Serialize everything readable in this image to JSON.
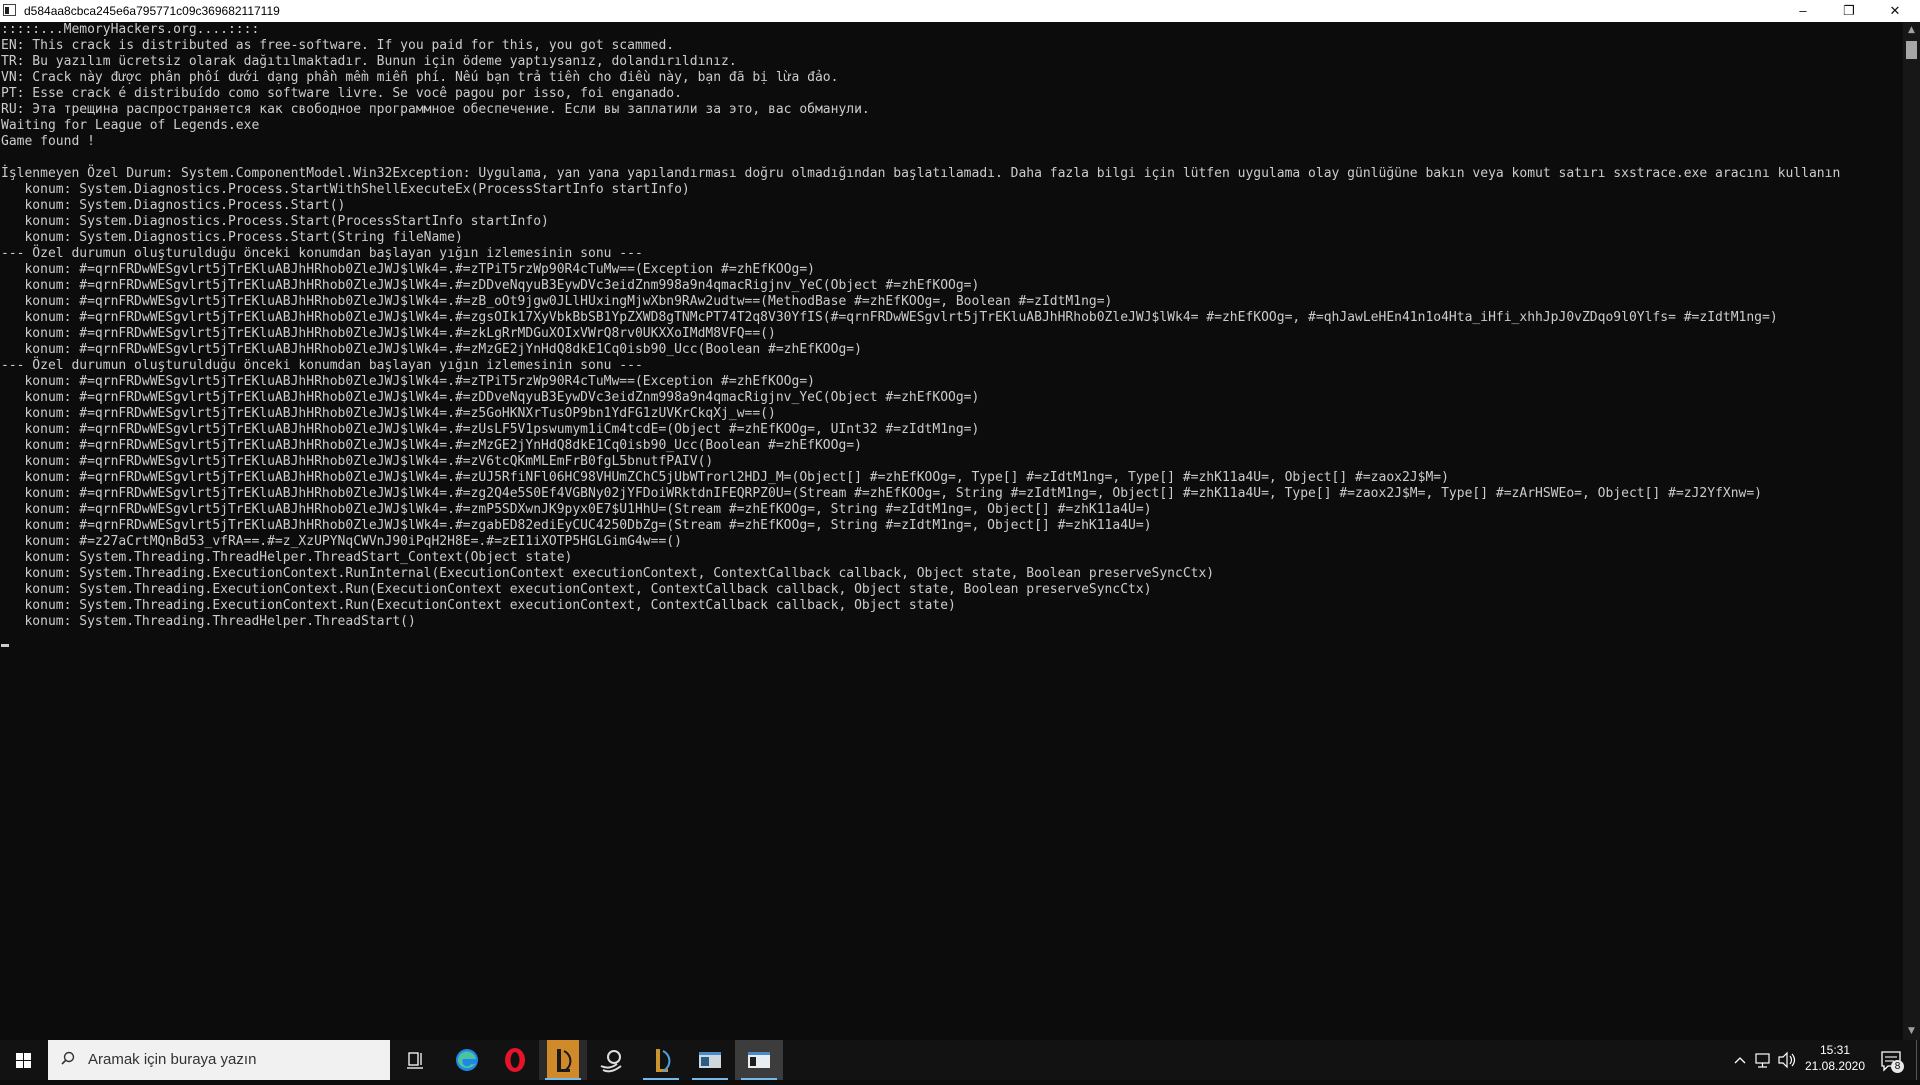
{
  "window": {
    "title": "d584aa8cbca245e6a795771c09c369682117119",
    "controls": {
      "minimize": "–",
      "restore": "❐",
      "close": "✕"
    }
  },
  "console": {
    "lines": [
      ":::::...MemoryHackers.org....::::",
      "EN: This crack is distributed as free-software. If you paid for this, you got scammed.",
      "TR: Bu yazılım ücretsiz olarak dağıtılmaktadır. Bunun için ödeme yaptıysanız, dolandırıldınız.",
      "VN: Crack này được phân phối dưới dạng phần mềm miễn phí. Nếu bạn trả tiền cho điều này, bạn đã bị lừa đảo.",
      "PT: Esse crack é distribuído como software livre. Se você pagou por isso, foi enganado.",
      "RU: Эта трещина распространяется как свободное программное обеспечение. Если вы заплатили за это, вас обманули.",
      "Waiting for League of Legends.exe",
      "Game found !",
      "",
      "İşlenmeyen Özel Durum: System.ComponentModel.Win32Exception: Uygulama, yan yana yapılandırması doğru olmadığından başlatılamadı. Daha fazla bilgi için lütfen uygulama olay günlüğüne bakın veya komut satırı sxstrace.exe aracını kullanın",
      "   konum: System.Diagnostics.Process.StartWithShellExecuteEx(ProcessStartInfo startInfo)",
      "   konum: System.Diagnostics.Process.Start()",
      "   konum: System.Diagnostics.Process.Start(ProcessStartInfo startInfo)",
      "   konum: System.Diagnostics.Process.Start(String fileName)",
      "--- Özel durumun oluşturulduğu önceki konumdan başlayan yığın izlemesinin sonu ---",
      "   konum: #=qrnFRDwWESgvlrt5jTrEKluABJhHRhob0ZleJWJ$lWk4=.#=zTPiT5rzWp90R4cTuMw==(Exception #=zhEfKOOg=)",
      "   konum: #=qrnFRDwWESgvlrt5jTrEKluABJhHRhob0ZleJWJ$lWk4=.#=zDDveNqyuB3EywDVc3eidZnm998a9n4qmacRigjnv_YeC(Object #=zhEfKOOg=)",
      "   konum: #=qrnFRDwWESgvlrt5jTrEKluABJhHRhob0ZleJWJ$lWk4=.#=zB_oOt9jgw0JLlHUxingMjwXbn9RAw2udtw==(MethodBase #=zhEfKOOg=, Boolean #=zIdtM1ng=)",
      "   konum: #=qrnFRDwWESgvlrt5jTrEKluABJhHRhob0ZleJWJ$lWk4=.#=zgsOIk17XyVbkBbSB1YpZXWD8gTNMcPT74T2q8V30YfIS(#=qrnFRDwWESgvlrt5jTrEKluABJhHRhob0ZleJWJ$lWk4= #=zhEfKOOg=, #=qhJawLeHEn41n1o4Hta_iHfi_xhhJpJ0vZDqo9l0Ylfs= #=zIdtM1ng=)",
      "   konum: #=qrnFRDwWESgvlrt5jTrEKluABJhHRhob0ZleJWJ$lWk4=.#=zkLgRrMDGuXOIxVWrQ8rv0UKXXoIMdM8VFQ==()",
      "   konum: #=qrnFRDwWESgvlrt5jTrEKluABJhHRhob0ZleJWJ$lWk4=.#=zMzGE2jYnHdQ8dkE1Cq0isb90_Ucc(Boolean #=zhEfKOOg=)",
      "--- Özel durumun oluşturulduğu önceki konumdan başlayan yığın izlemesinin sonu ---",
      "   konum: #=qrnFRDwWESgvlrt5jTrEKluABJhHRhob0ZleJWJ$lWk4=.#=zTPiT5rzWp90R4cTuMw==(Exception #=zhEfKOOg=)",
      "   konum: #=qrnFRDwWESgvlrt5jTrEKluABJhHRhob0ZleJWJ$lWk4=.#=zDDveNqyuB3EywDVc3eidZnm998a9n4qmacRigjnv_YeC(Object #=zhEfKOOg=)",
      "   konum: #=qrnFRDwWESgvlrt5jTrEKluABJhHRhob0ZleJWJ$lWk4=.#=z5GoHKNXrTusOP9bn1YdFG1zUVKrCkqXj_w==()",
      "   konum: #=qrnFRDwWESgvlrt5jTrEKluABJhHRhob0ZleJWJ$lWk4=.#=zUsLF5V1pswumym1iCm4tcdE=(Object #=zhEfKOOg=, UInt32 #=zIdtM1ng=)",
      "   konum: #=qrnFRDwWESgvlrt5jTrEKluABJhHRhob0ZleJWJ$lWk4=.#=zMzGE2jYnHdQ8dkE1Cq0isb90_Ucc(Boolean #=zhEfKOOg=)",
      "   konum: #=qrnFRDwWESgvlrt5jTrEKluABJhHRhob0ZleJWJ$lWk4=.#=zV6tcQKmMLEmFrB0fgL5bnutfPAIV()",
      "   konum: #=qrnFRDwWESgvlrt5jTrEKluABJhHRhob0ZleJWJ$lWk4=.#=zUJ5RfiNFl06HC98VHUmZChC5jUbWTrorl2HDJ_M=(Object[] #=zhEfKOOg=, Type[] #=zIdtM1ng=, Type[] #=zhK11a4U=, Object[] #=zaox2J$M=)",
      "   konum: #=qrnFRDwWESgvlrt5jTrEKluABJhHRhob0ZleJWJ$lWk4=.#=zg2Q4e5S0Ef4VGBNy02jYFDoiWRktdnIFEQRPZ0U=(Stream #=zhEfKOOg=, String #=zIdtM1ng=, Object[] #=zhK11a4U=, Type[] #=zaox2J$M=, Type[] #=zArHSWEo=, Object[] #=zJ2YfXnw=)",
      "   konum: #=qrnFRDwWESgvlrt5jTrEKluABJhHRhob0ZleJWJ$lWk4=.#=zmP5SDXwnJK9pyx0E7$U1HhU=(Stream #=zhEfKOOg=, String #=zIdtM1ng=, Object[] #=zhK11a4U=)",
      "   konum: #=qrnFRDwWESgvlrt5jTrEKluABJhHRhob0ZleJWJ$lWk4=.#=zgabED82ediEyCUC4250DbZg=(Stream #=zhEfKOOg=, String #=zIdtM1ng=, Object[] #=zhK11a4U=)",
      "   konum: #=z27aCrtMQnBd53_vfRA==.#=z_XzUPYNqCWVnJ90iPqH2H8E=.#=zEI1iXOTP5HGLGimG4w==()",
      "   konum: System.Threading.ThreadHelper.ThreadStart_Context(Object state)",
      "   konum: System.Threading.ExecutionContext.RunInternal(ExecutionContext executionContext, ContextCallback callback, Object state, Boolean preserveSyncCtx)",
      "   konum: System.Threading.ExecutionContext.Run(ExecutionContext executionContext, ContextCallback callback, Object state, Boolean preserveSyncCtx)",
      "   konum: System.Threading.ExecutionContext.Run(ExecutionContext executionContext, ContextCallback callback, Object state)",
      "   konum: System.Threading.ThreadHelper.ThreadStart()"
    ]
  },
  "scrollbar": {
    "up": "▲",
    "down": "▼"
  },
  "taskbar": {
    "search_placeholder": "Aramak için buraya yazın",
    "items": [
      {
        "name": "task-view-icon"
      },
      {
        "name": "edge-icon"
      },
      {
        "name": "opera-icon"
      },
      {
        "name": "league-client-icon"
      },
      {
        "name": "steam-like-icon"
      },
      {
        "name": "league-launcher-icon"
      },
      {
        "name": "window-app-icon"
      },
      {
        "name": "console-app-icon",
        "active": true
      }
    ],
    "clock_time": "15:31",
    "clock_date": "21.08.2020",
    "notification_count": "8"
  }
}
